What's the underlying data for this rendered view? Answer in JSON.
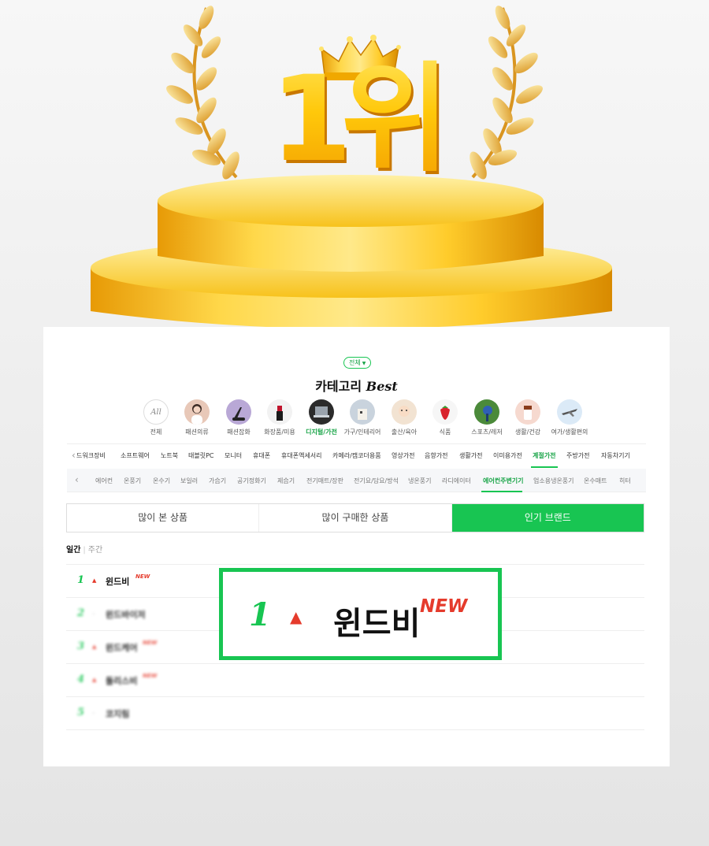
{
  "hero": {
    "title": "1위",
    "icons": [
      "crown-icon",
      "laurel-left-icon",
      "laurel-right-icon",
      "podium-icon"
    ]
  },
  "panel": {
    "scope_chip": "전체",
    "category_title": "카테고리",
    "category_title_suffix": "Best",
    "categories": [
      {
        "label": "전체",
        "icon_text": "All",
        "color": "#ffffff"
      },
      {
        "label": "패션의류",
        "color": "#e8c8b8"
      },
      {
        "label": "패션잡화",
        "color": "#b9a8d6"
      },
      {
        "label": "화장품/미용",
        "color": "#f2f2f2"
      },
      {
        "label": "디지털/가전",
        "color": "#2b2b2b"
      },
      {
        "label": "가구/인테리어",
        "color": "#c9d3dd"
      },
      {
        "label": "출산/육아",
        "color": "#f2e3d2"
      },
      {
        "label": "식품",
        "color": "#f6f6f6"
      },
      {
        "label": "스포츠/레저",
        "color": "#4b8a3a"
      },
      {
        "label": "생활/건강",
        "color": "#f6d9cf"
      },
      {
        "label": "여가/생활편의",
        "color": "#dbeaf7"
      }
    ],
    "active_category": "디지털/가전",
    "sub_row1": [
      "드워크장비",
      "소프트웨어",
      "노트북",
      "태블릿PC",
      "모니터",
      "휴대폰",
      "휴대폰액세서리",
      "카메라/캠코더용품",
      "영상가전",
      "음향가전",
      "생활가전",
      "이미용가전",
      "계절가전",
      "주방가전",
      "자동차기기"
    ],
    "sub_row1_active": "계절가전",
    "sub_row2": [
      "에어컨",
      "온풍기",
      "온수기",
      "보일러",
      "가습기",
      "공기정화기",
      "제습기",
      "전기매트/장판",
      "전기요/담요/방석",
      "냉온풍기",
      "라디에이터",
      "에어컨주변기기",
      "업소용냉온풍기",
      "온수매트",
      "히터"
    ],
    "sub_row2_active": "에어컨주변기기",
    "tabs": [
      "많이 본 상품",
      "많이 구매한 상품",
      "인기 브랜드"
    ],
    "active_tab": "인기 브랜드",
    "period": {
      "daily": "일간",
      "separator": "|",
      "weekly": "주간"
    },
    "ranking": [
      {
        "rank": "1",
        "trend": "▲",
        "name": "윈드비",
        "badge": "NEW"
      },
      {
        "rank": "2",
        "trend": "–",
        "name": "윈드바이저",
        "badge": ""
      },
      {
        "rank": "3",
        "trend": "▲",
        "name": "윈드케어",
        "badge": "NEW"
      },
      {
        "rank": "4",
        "trend": "▲",
        "name": "돌리스비",
        "badge": "NEW"
      },
      {
        "rank": "5",
        "trend": "–",
        "name": "코지림",
        "badge": ""
      }
    ],
    "highlight": {
      "rank": "1",
      "trend": "▲",
      "name": "윈드비",
      "badge": "NEW"
    },
    "colors": {
      "accent": "#18c552",
      "up": "#e53b2c",
      "gold": "#f5b400"
    }
  }
}
